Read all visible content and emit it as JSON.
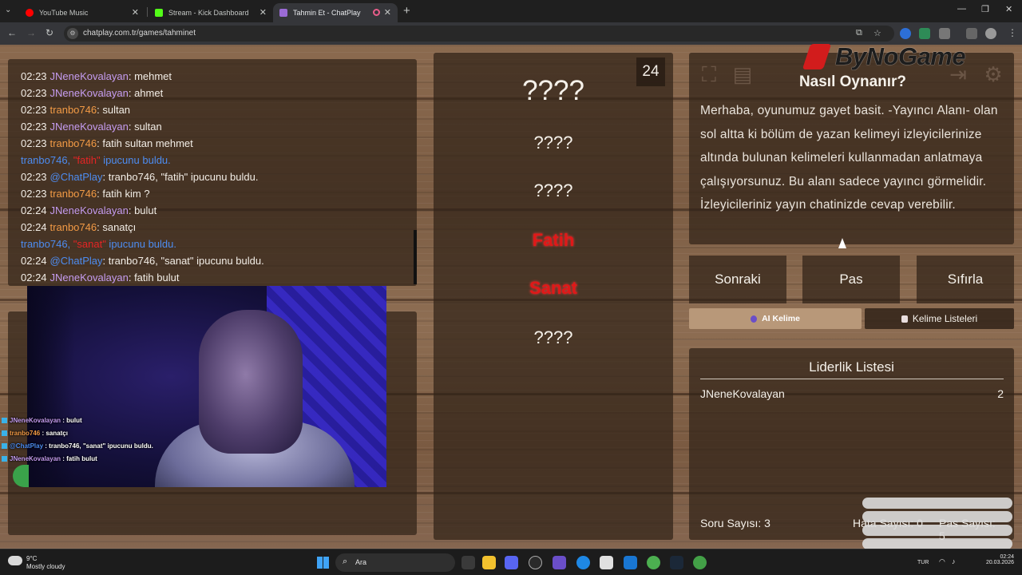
{
  "browser": {
    "tabs": [
      {
        "title": "YouTube Music",
        "favicon": "youtube-music-icon",
        "color": "#ff0000"
      },
      {
        "title": "Stream - Kick Dashboard",
        "favicon": "kick-icon",
        "color": "#53fc18"
      },
      {
        "title": "Tahmin Et - ChatPlay",
        "favicon": "chatplay-icon",
        "color": "#9b6bd6"
      }
    ],
    "url": "chatplay.com.tr/games/tahminet"
  },
  "chat": {
    "lines": [
      {
        "time": "02:23",
        "user": "JNeneKovalayan",
        "text": ": mehmet",
        "user_color": "#c59cf0"
      },
      {
        "time": "02:23",
        "user": "JNeneKovalayan",
        "text": ": ahmet",
        "user_color": "#c59cf0"
      },
      {
        "time": "02:23",
        "user": "tranbo746",
        "text": ": sultan",
        "user_color": "#f29a45"
      },
      {
        "time": "02:23",
        "user": "JNeneKovalayan",
        "text": ": sultan",
        "user_color": "#c59cf0"
      },
      {
        "time": "02:23",
        "user": "tranbo746",
        "text": ": fatih sultan mehmet",
        "user_color": "#f29a45"
      },
      {
        "time": "",
        "user": "tranbo746, ",
        "hint": "\"fatih\"",
        "text": " ipucunu buldu.",
        "user_color": "#4d8cf0",
        "system": true
      },
      {
        "time": "02:23",
        "user": "@ChatPlay",
        "text": ": tranbo746, \"fatih\" ipucunu buldu.",
        "user_color": "#4d8cf0"
      },
      {
        "time": "02:23",
        "user": "tranbo746",
        "text": ": fatih kim ?",
        "user_color": "#f29a45"
      },
      {
        "time": "02:24",
        "user": "JNeneKovalayan",
        "text": ": bulut",
        "user_color": "#c59cf0"
      },
      {
        "time": "02:24",
        "user": "tranbo746",
        "text": ": sanatçı",
        "user_color": "#f29a45"
      },
      {
        "time": "",
        "user": "tranbo746, ",
        "hint": "\"sanat\"",
        "text": " ipucunu buldu.",
        "user_color": "#4d8cf0",
        "system": true
      },
      {
        "time": "02:24",
        "user": "@ChatPlay",
        "text": ": tranbo746, \"sanat\" ipucunu buldu.",
        "user_color": "#4d8cf0"
      },
      {
        "time": "02:24",
        "user": "JNeneKovalayan",
        "text": ": fatih bulut",
        "user_color": "#c59cf0"
      }
    ]
  },
  "overlay_chat": [
    {
      "user": "JNeneKovalayan",
      "text": " : bulut",
      "color": "#c59cf0"
    },
    {
      "user": "tranbo746",
      "text": " : sanatçı",
      "color": "#f29a45"
    },
    {
      "user": "@ChatPlay",
      "text": " : tranbo746, \"sanat\" ipucunu buldu.",
      "color": "#4d8cf0"
    },
    {
      "user": "JNeneKovalayan",
      "text": " : fatih bulut",
      "color": "#c59cf0"
    }
  ],
  "game": {
    "timer": "24",
    "main_word": "????",
    "hints": [
      {
        "text": "????",
        "revealed": false
      },
      {
        "text": "????",
        "revealed": false
      },
      {
        "text": "Fatih",
        "revealed": true
      },
      {
        "text": "Sanat",
        "revealed": true
      },
      {
        "text": "????",
        "revealed": false
      }
    ]
  },
  "how_to": {
    "title": "Nasıl Oynanır?",
    "text": "Merhaba, oyunumuz gayet basit. -Yayıncı Alanı- olan sol altta ki bölüm de yazan kelimeyi izleyicilerinize altında bulunan kelimeleri kullanmadan anlatmaya çalışıyorsunuz. Bu alanı sadece yayıncı görmelidir. İzleyicileriniz yayın chatinizde cevap verebilir."
  },
  "brand": "ByNoGame",
  "buttons": {
    "next": "Sonraki",
    "pass": "Pas",
    "reset": "Sıfırla",
    "ai_word": "AI Kelime",
    "word_lists": "Kelime Listeleri"
  },
  "leaderboard": {
    "title": "Liderlik Listesi",
    "rows": [
      {
        "name": "JNeneKovalayan",
        "score": "2"
      }
    ],
    "question_count": "Soru Sayısı: 3",
    "error_count": "Hata Sayısı: 0",
    "pass_count": "Pas Sayısı: 5"
  },
  "taskbar": {
    "temp": "9°C",
    "weather": "Mostly cloudy",
    "search": "Ara",
    "lang": "TUR",
    "time": "02:24",
    "date": "20.03.2026"
  }
}
